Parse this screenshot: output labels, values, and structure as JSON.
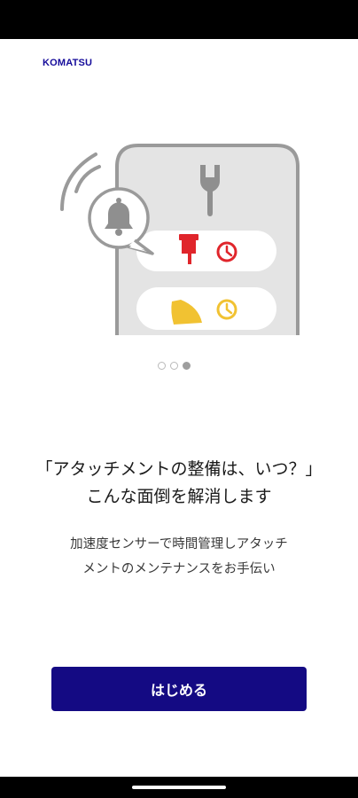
{
  "brand": {
    "logo_text": "KOMATSU"
  },
  "onboarding": {
    "page_count": 3,
    "active_page": 3,
    "headline_line1": "「アタッチメントの整備は、いつ？」",
    "headline_line2": "こんな面倒を解消します",
    "body_line1": "加速度センサーで時間管理しアタッチ",
    "body_line2": "メントのメンテナンスをお手伝い",
    "start_button_label": "はじめる"
  },
  "colors": {
    "brand_navy": "#140a83",
    "alert_red": "#e0252b",
    "warning_yellow": "#f1c232",
    "device_gray": "#e4e4e4"
  }
}
